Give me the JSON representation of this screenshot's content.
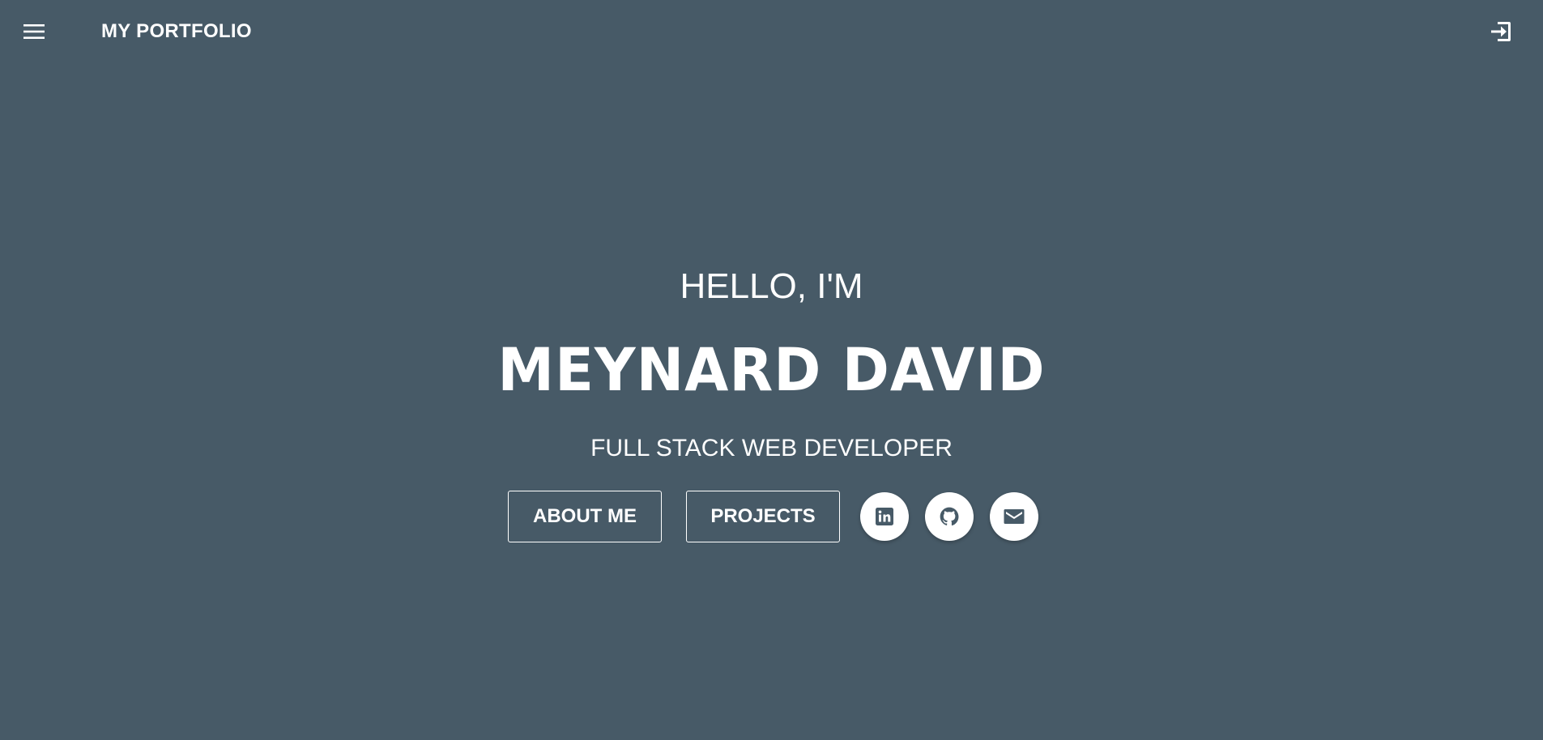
{
  "header": {
    "title": "MY PORTFOLIO",
    "menu_icon": "hamburger-menu-icon",
    "login_icon": "login-icon"
  },
  "hero": {
    "greeting": "HELLO, I'M",
    "name": "MEYNARD DAVID",
    "role": "FULL STACK WEB DEVELOPER"
  },
  "actions": {
    "about_label": "ABOUT ME",
    "projects_label": "PROJECTS",
    "social": [
      {
        "icon": "linkedin-icon"
      },
      {
        "icon": "github-icon"
      },
      {
        "icon": "email-icon"
      }
    ]
  },
  "colors": {
    "background": "#475a67",
    "text": "#ffffff",
    "icon_dark": "#475a67"
  }
}
